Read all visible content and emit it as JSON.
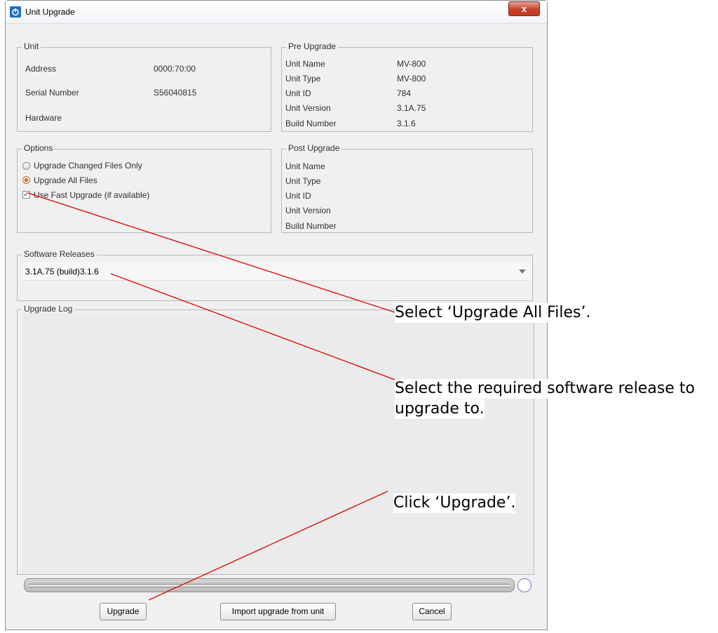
{
  "window": {
    "title": "Unit Upgrade",
    "close_label": "x"
  },
  "unit": {
    "group_title": "Unit",
    "rows": [
      {
        "label": "Address",
        "value": "0000:70:00"
      },
      {
        "label": "Serial Number",
        "value": "S56040815"
      },
      {
        "label": "Hardware",
        "value": ""
      }
    ]
  },
  "pre_upgrade": {
    "group_title": "Pre Upgrade",
    "rows": [
      {
        "label": "Unit Name",
        "value": "MV-800"
      },
      {
        "label": "Unit Type",
        "value": "MV-800"
      },
      {
        "label": "Unit ID",
        "value": "784"
      },
      {
        "label": "Unit Version",
        "value": "3.1A.75"
      },
      {
        "label": "Build Number",
        "value": "3.1.6"
      }
    ]
  },
  "options": {
    "group_title": "Options",
    "radio_changed": "Upgrade Changed Files Only",
    "radio_all": "Upgrade All Files",
    "selected": "all",
    "checkbox_fast": "Use Fast Upgrade (if available)",
    "checkbox_fast_checked": true
  },
  "post_upgrade": {
    "group_title": "Post Upgrade",
    "rows": [
      {
        "label": "Unit Name",
        "value": ""
      },
      {
        "label": "Unit Type",
        "value": ""
      },
      {
        "label": "Unit ID",
        "value": ""
      },
      {
        "label": "Unit Version",
        "value": ""
      },
      {
        "label": "Build Number",
        "value": ""
      }
    ]
  },
  "software_releases": {
    "group_title": "Software Releases",
    "selected": "3.1A.75 (build)3.1.6"
  },
  "upgrade_log": {
    "group_title": "Upgrade Log"
  },
  "buttons": {
    "upgrade": "Upgrade",
    "import": "Import upgrade from unit",
    "cancel": "Cancel"
  },
  "annotations": {
    "upgrade_all": "Select ‘Upgrade All Files’.",
    "release_line1": "Select the required software release to",
    "release_line2": "upgrade to.",
    "click_upgrade": "Click ‘Upgrade’."
  },
  "colors": {
    "annotation_line": "#e00000",
    "radio_selected": "#e0641e",
    "close_button": "#c7412a"
  },
  "icons": [
    "app-logo-icon",
    "close-icon",
    "dropdown-arrow-icon",
    "busy-indicator-icon"
  ]
}
